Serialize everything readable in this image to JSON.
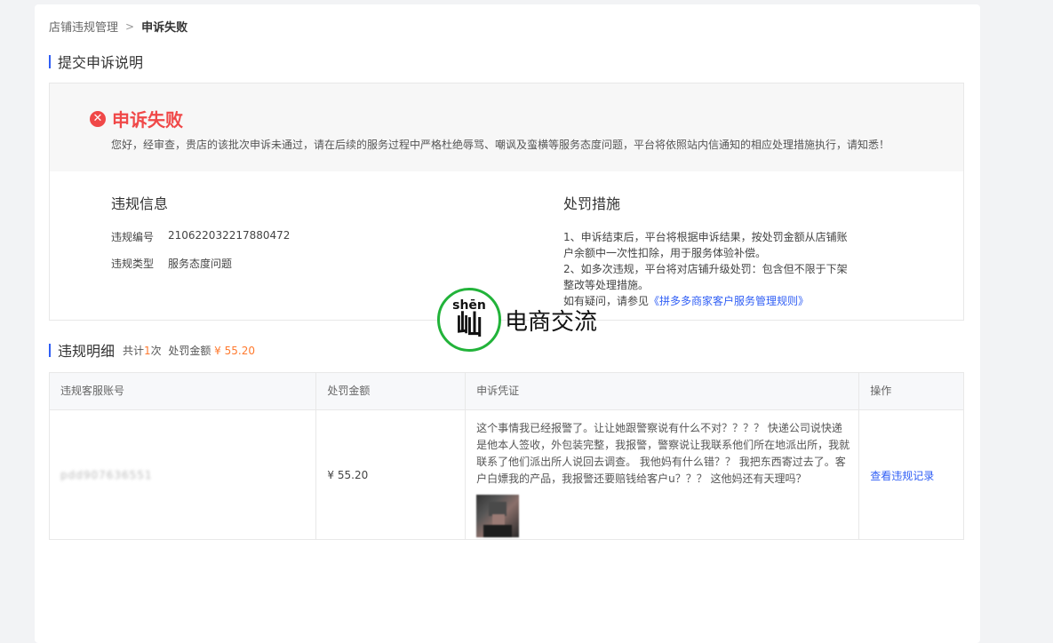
{
  "breadcrumb": {
    "parent": "店铺违规管理",
    "separator": ">",
    "current": "申诉失败"
  },
  "section_appeal": {
    "title": "提交申诉说明"
  },
  "result": {
    "status": "申诉失败",
    "icon": "close-circle-icon",
    "description": "您好，经审查，贵店的该批次申诉未通过，请在后续的服务过程中严格杜绝辱骂、嘲讽及蛮横等服务态度问题，平台将依照站内信通知的相应处理措施执行，请知悉！"
  },
  "violation_info": {
    "title": "违规信息",
    "number_label": "违规编号",
    "number_value": "210622032217880472",
    "type_label": "违规类型",
    "type_value": "服务态度问题"
  },
  "penalty": {
    "title": "处罚措施",
    "line1": "1、申诉结束后，平台将根据申诉结果，按处罚金额从店铺账户余额中一次性扣除，用于服务体验补偿。",
    "line2": "2、如多次违规，平台将对店铺升级处罚：包含但不限于下架整改等处理措施。",
    "line3_prefix": "如有疑问，请参见",
    "line3_link": "《拼多多商家客户服务管理规则》"
  },
  "section_detail": {
    "title": "违规明细",
    "total_prefix": "共计",
    "total_count": "1",
    "total_suffix": "次",
    "amount_label": "处罚金额",
    "amount_value": "¥ 55.20"
  },
  "table": {
    "headers": [
      "违规客服账号",
      "处罚金额",
      "申诉凭证",
      "操作"
    ],
    "rows": [
      {
        "account": "pdd907636551",
        "amount": "¥ 55.20",
        "evidence": "这个事情我已经报警了。让让她跟警察说有什么不对？？？？ 快递公司说快递是他本人签收，外包装完整，我报警，警察说让我联系他们所在地派出所，我就联系了他们派出所人说回去调查。 我他妈有什么错？？ 我把东西寄过去了。客户白嫖我的产品，我报警还要赔钱给客户u？？？ 这他妈还有天理吗？",
        "action": "查看违规记录"
      }
    ]
  },
  "watermark": {
    "pinyin": "shēn",
    "char": "屾",
    "text": "电商交流"
  },
  "colors": {
    "accent": "#2f5ef5",
    "error": "#f04848",
    "orange": "#ff7a2f",
    "watermark_ring": "#22b33a"
  }
}
